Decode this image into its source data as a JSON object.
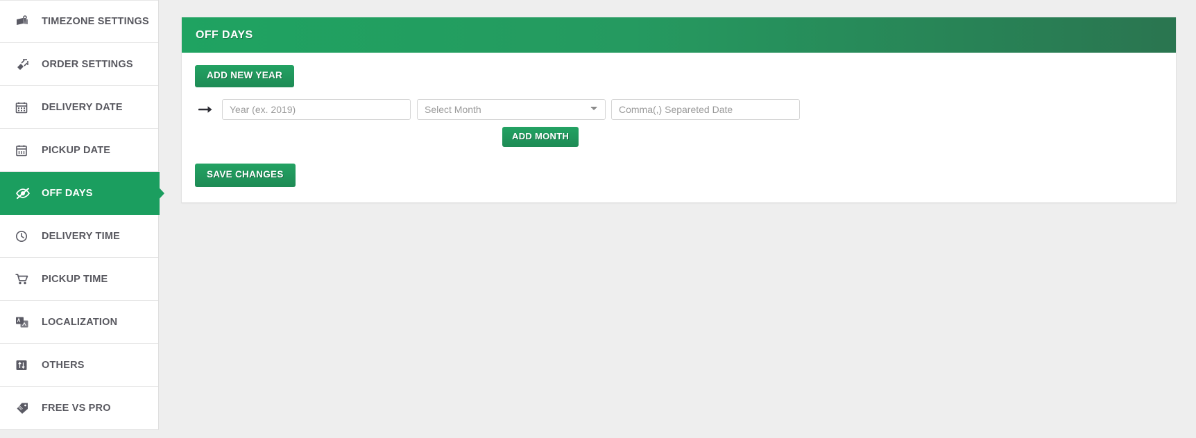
{
  "sidebar": {
    "items": [
      {
        "label": "TIMEZONE SETTINGS",
        "icon": "map-marker-flag-icon",
        "active": false
      },
      {
        "label": "ORDER SETTINGS",
        "icon": "plug-icon",
        "active": false
      },
      {
        "label": "DELIVERY DATE",
        "icon": "calendar-grid-icon",
        "active": false
      },
      {
        "label": "PICKUP DATE",
        "icon": "calendar-icon",
        "active": false
      },
      {
        "label": "OFF DAYS",
        "icon": "eye-slash-icon",
        "active": true
      },
      {
        "label": "DELIVERY TIME",
        "icon": "clock-icon",
        "active": false
      },
      {
        "label": "PICKUP TIME",
        "icon": "shopping-cart-icon",
        "active": false
      },
      {
        "label": "LOCALIZATION",
        "icon": "language-icon",
        "active": false
      },
      {
        "label": "OTHERS",
        "icon": "sliders-icon",
        "active": false
      },
      {
        "label": "FREE VS PRO",
        "icon": "tags-icon",
        "active": false
      }
    ]
  },
  "panel": {
    "title": "OFF DAYS",
    "add_new_year_label": "ADD NEW YEAR",
    "add_month_label": "ADD MONTH",
    "save_changes_label": "SAVE CHANGES",
    "row_arrow_icon": "arrow-right-icon",
    "fields": {
      "year": {
        "value": "",
        "placeholder": "Year (ex. 2019)"
      },
      "month": {
        "selected": "Select Month",
        "options": [
          "Select Month"
        ]
      },
      "dates": {
        "value": "",
        "placeholder": "Comma(,) Separeted Date"
      }
    }
  },
  "colors": {
    "accent_green": "#1b9e5f",
    "header_gradient_start": "#1fa361",
    "header_gradient_end": "#2a7550",
    "button_green_top": "#23a263",
    "button_green_bottom": "#1e8b55",
    "page_background": "#eeeeee",
    "sidebar_background": "#ffffff",
    "nav_text": "#58585f"
  }
}
